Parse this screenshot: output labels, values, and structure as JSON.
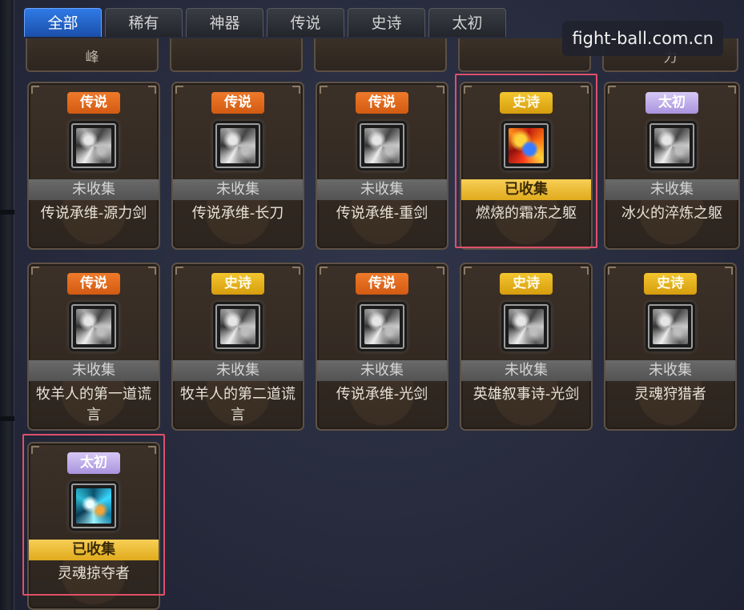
{
  "tabs": [
    {
      "label": "全部",
      "active": true
    },
    {
      "label": "稀有",
      "active": false
    },
    {
      "label": "神器",
      "active": false
    },
    {
      "label": "传说",
      "active": false
    },
    {
      "label": "史诗",
      "active": false
    },
    {
      "label": "太初",
      "active": false
    }
  ],
  "watermark": "fight-ball.com.cn",
  "partial_row": [
    "峰",
    "",
    "",
    "",
    "力"
  ],
  "status_labels": {
    "uncollected": "未收集",
    "collected": "已收集"
  },
  "rarity_colors": {
    "传说": "#e2691c",
    "史诗": "#e0ad16",
    "太初": "#bba8e8"
  },
  "items": [
    {
      "rarity": "传说",
      "rarity_class": "legend",
      "status": "未收集",
      "collected": false,
      "name": "传说承维-源力剑",
      "icon": "gray-sword-icon",
      "highlighted": false
    },
    {
      "rarity": "传说",
      "rarity_class": "legend",
      "status": "未收集",
      "collected": false,
      "name": "传说承维-长刀",
      "icon": "gray-blade-icon",
      "highlighted": false
    },
    {
      "rarity": "传说",
      "rarity_class": "legend",
      "status": "未收集",
      "collected": false,
      "name": "传说承维-重剑",
      "icon": "gray-greatsword-icon",
      "highlighted": false
    },
    {
      "rarity": "史诗",
      "rarity_class": "epic",
      "status": "已收集",
      "collected": true,
      "name": "燃烧的霜冻之躯",
      "icon": "fire-frost-icon",
      "highlighted": true
    },
    {
      "rarity": "太初",
      "rarity_class": "primal",
      "status": "未收集",
      "collected": false,
      "name": "冰火的淬炼之躯",
      "icon": "gray-armor-icon",
      "highlighted": false
    },
    {
      "rarity": "传说",
      "rarity_class": "legend",
      "status": "未收集",
      "collected": false,
      "name": "牧羊人的第一道谎言",
      "icon": "gray-skull-icon",
      "highlighted": false
    },
    {
      "rarity": "史诗",
      "rarity_class": "epic",
      "status": "未收集",
      "collected": false,
      "name": "牧羊人的第二道谎言",
      "icon": "gray-mask-icon",
      "highlighted": false
    },
    {
      "rarity": "传说",
      "rarity_class": "legend",
      "status": "未收集",
      "collected": false,
      "name": "传说承维-光剑",
      "icon": "gray-lightsword-icon",
      "highlighted": false
    },
    {
      "rarity": "史诗",
      "rarity_class": "epic",
      "status": "未收集",
      "collected": false,
      "name": "英雄叙事诗-光剑",
      "icon": "gray-epic-sword-icon",
      "highlighted": false
    },
    {
      "rarity": "史诗",
      "rarity_class": "epic",
      "status": "未收集",
      "collected": false,
      "name": "灵魂狩猎者",
      "icon": "gray-hunter-icon",
      "highlighted": false
    },
    {
      "rarity": "太初",
      "rarity_class": "primal",
      "status": "已收集",
      "collected": true,
      "name": "灵魂掠夺者",
      "icon": "ice-soul-icon",
      "highlighted": true
    }
  ]
}
